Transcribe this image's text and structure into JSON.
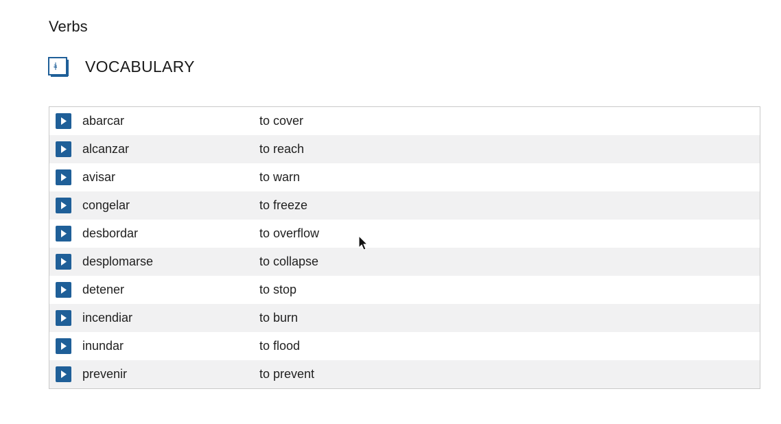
{
  "section": {
    "title": "Verbs"
  },
  "vocabulary": {
    "title": "VOCABULARY",
    "icon": "book-icon",
    "play_icon": "play-icon",
    "play_color": "#1f5f98",
    "items": [
      {
        "term": "abarcar",
        "meaning": "to cover"
      },
      {
        "term": "alcanzar",
        "meaning": "to reach"
      },
      {
        "term": "avisar",
        "meaning": "to warn"
      },
      {
        "term": "congelar",
        "meaning": "to freeze"
      },
      {
        "term": "desbordar",
        "meaning": "to overflow"
      },
      {
        "term": "desplomarse",
        "meaning": "to collapse"
      },
      {
        "term": "detener",
        "meaning": "to stop"
      },
      {
        "term": "incendiar",
        "meaning": "to burn"
      },
      {
        "term": "inundar",
        "meaning": "to flood"
      },
      {
        "term": "prevenir",
        "meaning": "to prevent"
      }
    ]
  }
}
